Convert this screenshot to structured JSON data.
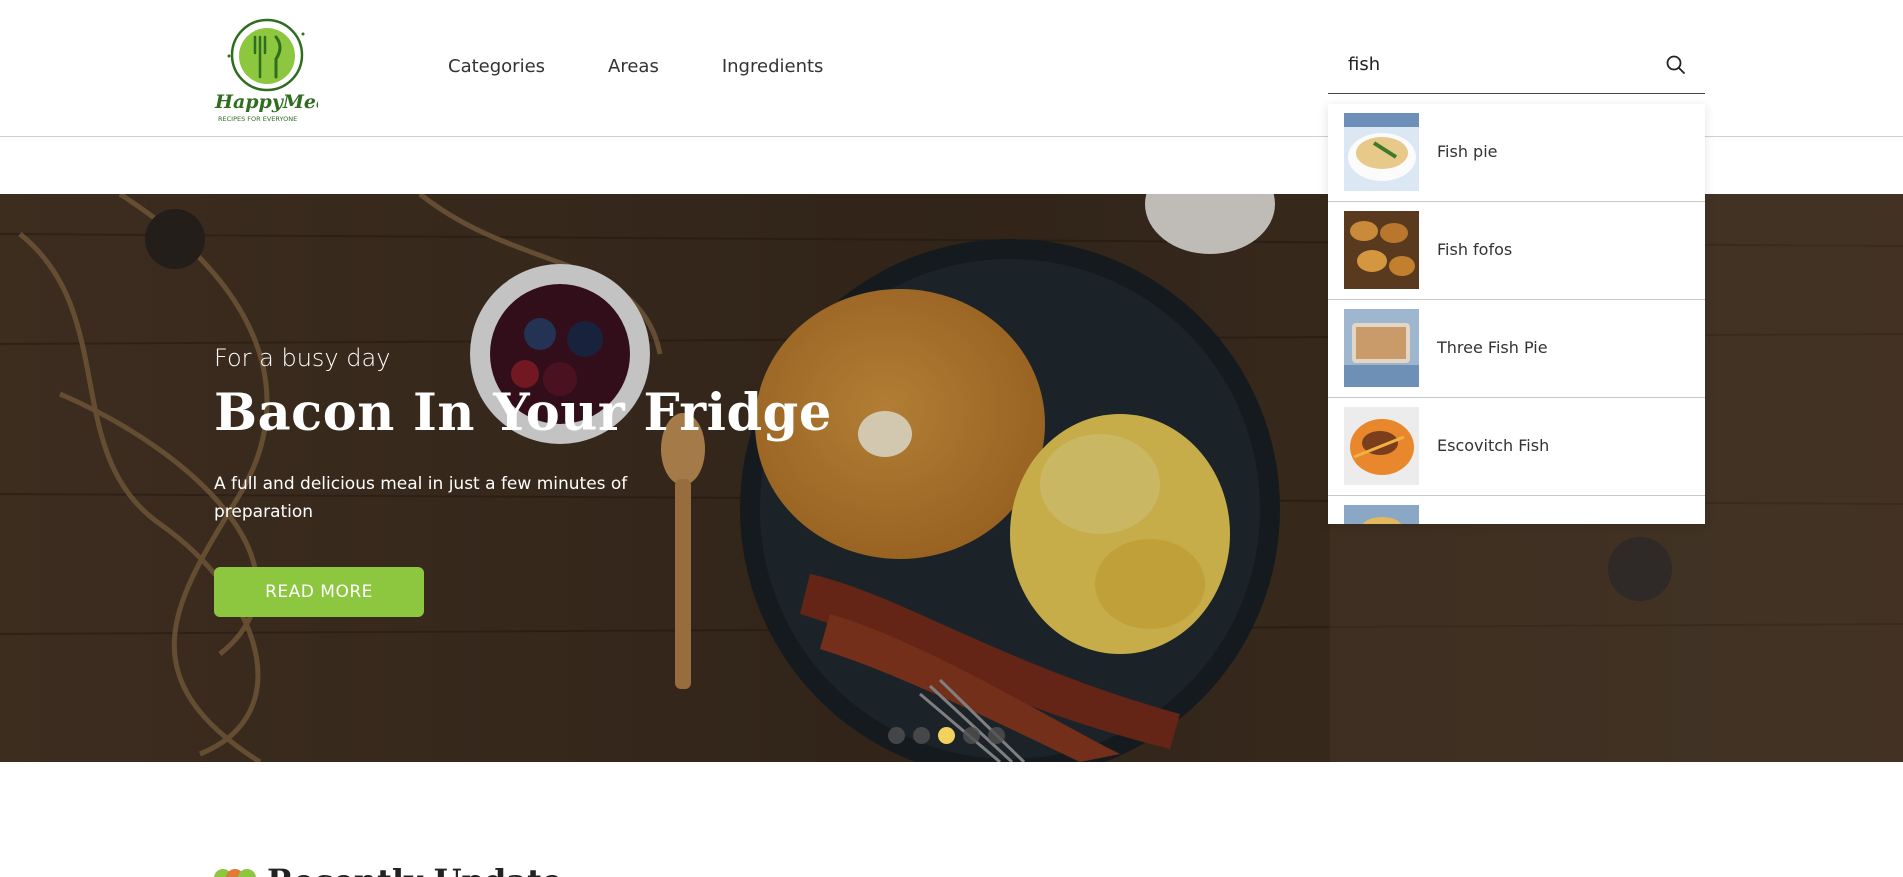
{
  "brand": {
    "name": "HappyMeal",
    "tagline": "RECIPES FOR EVERYONE",
    "accent_color": "#8dc63f",
    "dark_green": "#2f6d1f"
  },
  "nav": {
    "items": [
      {
        "label": "Categories"
      },
      {
        "label": "Areas"
      },
      {
        "label": "Ingredients"
      }
    ]
  },
  "search": {
    "value": "fish",
    "icon": "search-icon"
  },
  "search_results": [
    {
      "name": "Fish pie"
    },
    {
      "name": "Fish fofos"
    },
    {
      "name": "Three Fish Pie"
    },
    {
      "name": "Escovitch Fish"
    }
  ],
  "hero": {
    "subtitle": "For a busy day",
    "title": "Bacon In Your Fridge",
    "description": "A full and delicious meal in just a few minutes of preparation",
    "button_label": "READ MORE",
    "slides_total": 5,
    "active_slide": 3
  },
  "recent": {
    "title": "Recently Update"
  }
}
